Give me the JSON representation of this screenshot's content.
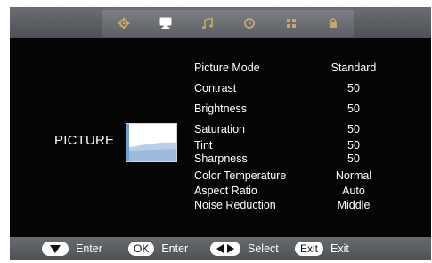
{
  "tabs": [
    {
      "icon": "gear-icon",
      "active": false
    },
    {
      "icon": "monitor-icon",
      "active": true
    },
    {
      "icon": "music-note-icon",
      "active": false
    },
    {
      "icon": "clock-icon",
      "active": false
    },
    {
      "icon": "grid-icon",
      "active": false
    },
    {
      "icon": "lock-icon",
      "active": false
    }
  ],
  "section": {
    "title": "PICTURE"
  },
  "menu": [
    {
      "label": "Picture Mode",
      "value": "Standard"
    },
    {
      "label": "Contrast",
      "value": "50"
    },
    {
      "label": "Brightness",
      "value": "50"
    },
    {
      "label": "Saturation",
      "value": "50"
    },
    {
      "label": "Tint",
      "value": "50"
    },
    {
      "label": "Sharpness",
      "value": "50"
    },
    {
      "label": "Color Temperature",
      "value": "Normal"
    },
    {
      "label": "Aspect Ratio",
      "value": "Auto"
    },
    {
      "label": "Noise Reduction",
      "value": "Middle"
    }
  ],
  "footer": {
    "down_text": "Enter",
    "ok_key": "OK",
    "ok_text": "Enter",
    "lr_text": "Select",
    "exit_key": "Exit",
    "exit_text": "Exit"
  },
  "colors": {
    "background": "#050505",
    "bar": "#5a5d61",
    "text": "#ffffff"
  }
}
